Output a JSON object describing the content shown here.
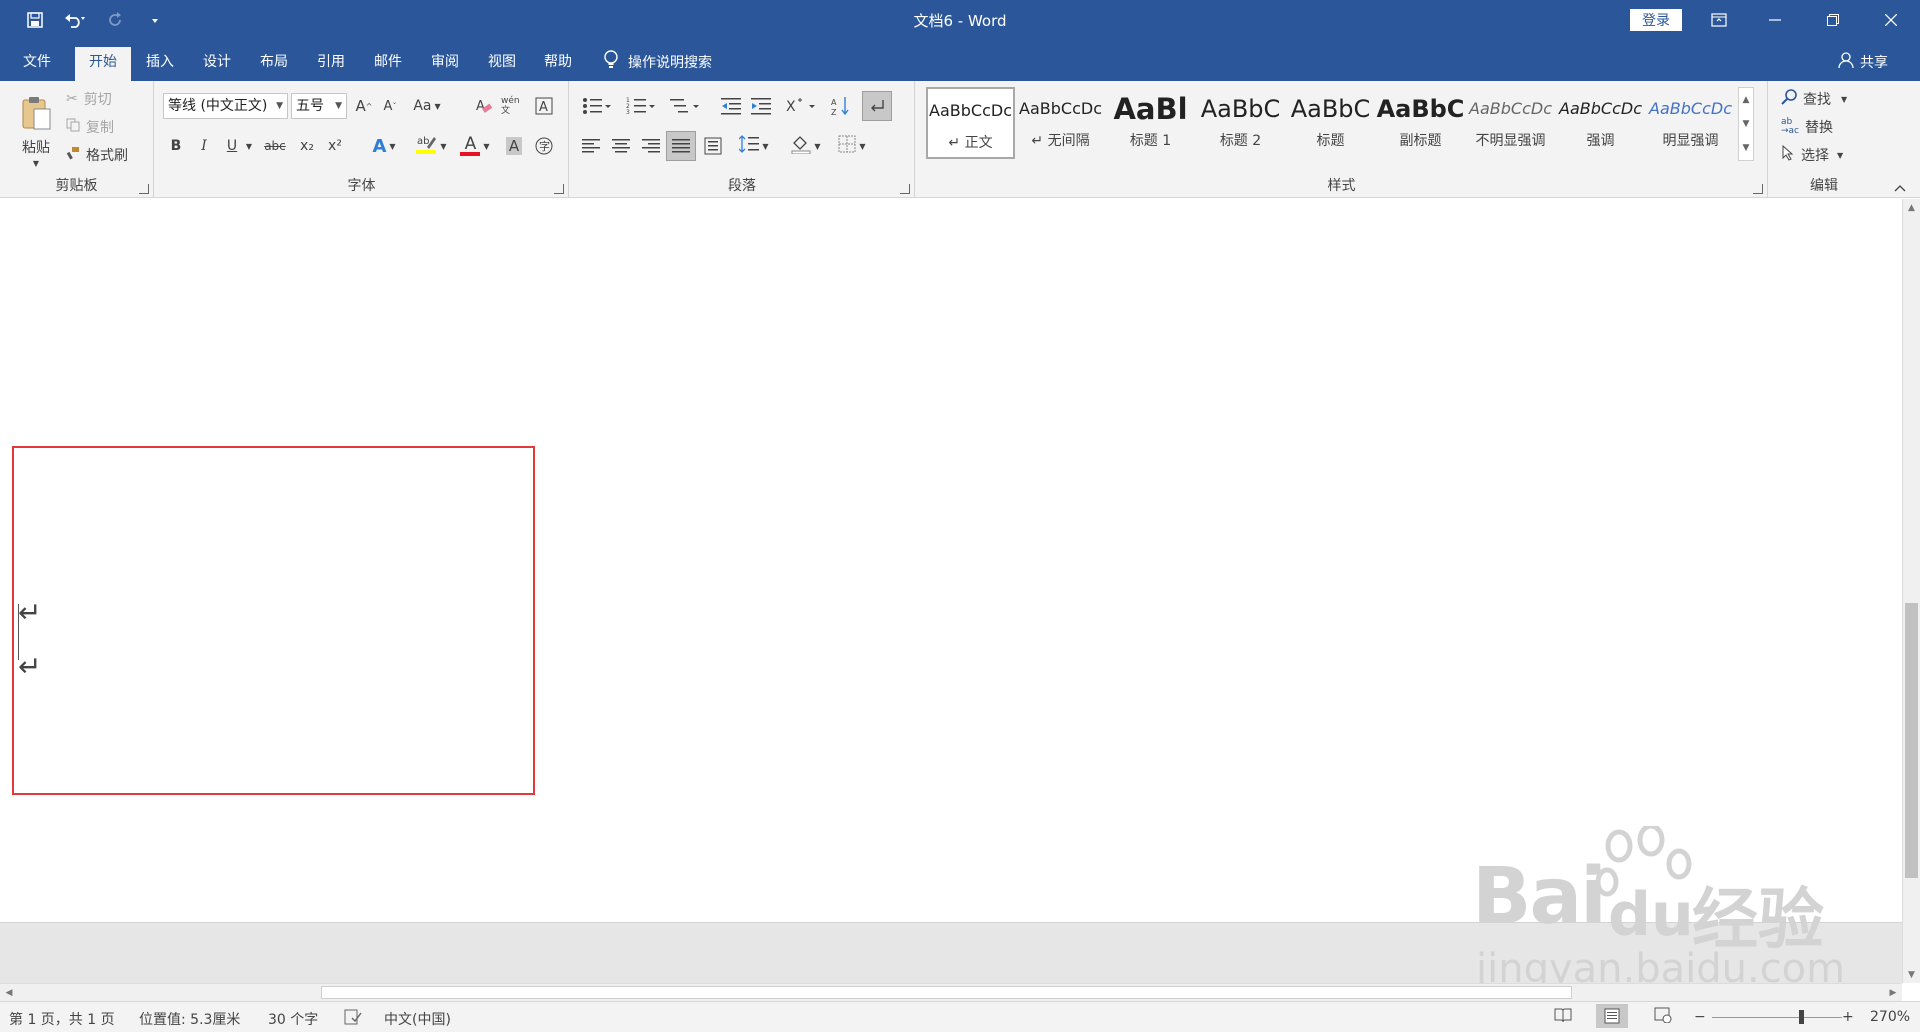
{
  "app": {
    "title": "文档6  -  Word",
    "login_label": "登录"
  },
  "quick_access": {
    "icons": [
      "save-icon",
      "undo-icon",
      "redo-icon",
      "customize-icon"
    ]
  },
  "window_controls": {
    "icons": [
      "ribbon-display-icon",
      "minimize-icon",
      "restore-icon",
      "close-icon"
    ]
  },
  "menu_tabs": [
    {
      "label": "文件",
      "active": false
    },
    {
      "label": "开始",
      "active": true
    },
    {
      "label": "插入",
      "active": false
    },
    {
      "label": "设计",
      "active": false
    },
    {
      "label": "布局",
      "active": false
    },
    {
      "label": "引用",
      "active": false
    },
    {
      "label": "邮件",
      "active": false
    },
    {
      "label": "审阅",
      "active": false
    },
    {
      "label": "视图",
      "active": false
    },
    {
      "label": "帮助",
      "active": false
    }
  ],
  "tell_me": {
    "label": "操作说明搜索",
    "icon": "lightbulb-icon"
  },
  "share": {
    "label": "共享",
    "icon": "person-icon"
  },
  "clipboard": {
    "group_label": "剪贴板",
    "paste_label": "粘贴",
    "cut_label": "剪切",
    "copy_label": "复制",
    "format_painter_label": "格式刷"
  },
  "font": {
    "group_label": "字体",
    "font_name": "等线 (中文正文)",
    "font_size": "五号",
    "change_case_label": "Aa",
    "buttons": {
      "bold": "B",
      "italic": "I",
      "underline": "U",
      "strikethrough": "abc",
      "subscript": "x₂",
      "superscript": "x²",
      "font_color_letter": "A",
      "grow_font": "A",
      "shrink_font": "A"
    },
    "phonetic_label": "wén 文"
  },
  "paragraph": {
    "group_label": "段落"
  },
  "styles": {
    "group_label": "样式",
    "items": [
      {
        "sample": "AaBbCcDc",
        "name": "↵ 正文",
        "selected": true
      },
      {
        "sample": "AaBbCcDc",
        "name": "↵ 无间隔",
        "selected": false
      },
      {
        "sample": "AaBl",
        "name": "标题 1",
        "selected": false
      },
      {
        "sample": "AaBbC",
        "name": "标题 2",
        "selected": false
      },
      {
        "sample": "AaBbC",
        "name": "标题",
        "selected": false
      },
      {
        "sample": "AaBbC",
        "name": "副标题",
        "selected": false
      },
      {
        "sample": "AaBbCcDc",
        "name": "不明显强调",
        "selected": false
      },
      {
        "sample": "AaBbCcDc",
        "name": "强调",
        "selected": false
      },
      {
        "sample": "AaBbCcDc",
        "name": "明显强调",
        "selected": false
      }
    ]
  },
  "editing": {
    "group_label": "编辑",
    "find_label": "查找",
    "replace_label": "替换",
    "select_label": "选择"
  },
  "document": {
    "paragraph_mark": "↵",
    "highlight_color": "#e03a3a"
  },
  "status": {
    "page": "第 1 页，共 1 页",
    "position": "位置值: 5.3厘米",
    "word_count": "30 个字",
    "language": "中文(中国)",
    "zoom_minus": "−",
    "zoom_plus": "+",
    "zoom": "270%"
  },
  "watermark": {
    "brand": "Bai",
    "brand2": "du",
    "brand_cn": "经验",
    "url": "jingyan.baidu.com"
  },
  "colors": {
    "accent": "#2b579a",
    "ribbon_bg": "#f3f3f3"
  }
}
